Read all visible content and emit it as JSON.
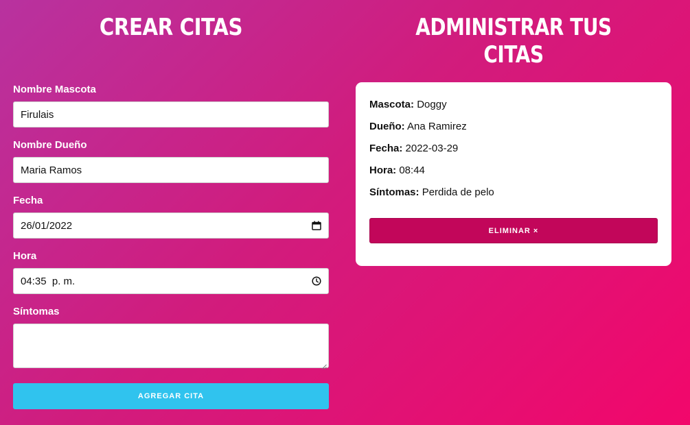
{
  "create": {
    "title": "Crear Citas",
    "fields": {
      "pet": {
        "label": "Nombre Mascota",
        "value": "Firulais"
      },
      "owner": {
        "label": "Nombre Dueño",
        "value": "Maria Ramos"
      },
      "date": {
        "label": "Fecha",
        "value": "26/01/2022"
      },
      "time": {
        "label": "Hora",
        "value": "04:35  p. m."
      },
      "symptoms": {
        "label": "Síntomas",
        "value": ""
      }
    },
    "submit_label": "Agregar Cita"
  },
  "manage": {
    "title": "Administrar tus Citas",
    "appointment": {
      "pet_label": "Mascota:",
      "pet": "Doggy",
      "owner_label": "Dueño:",
      "owner": "Ana Ramirez",
      "date_label": "Fecha:",
      "date": "2022-03-29",
      "time_label": "Hora:",
      "time": "08:44",
      "symptoms_label": "Síntomas:",
      "symptoms": "Perdida de pelo",
      "delete_label": "Eliminar ×"
    }
  },
  "colors": {
    "gradient_start": "#b8329f",
    "gradient_end": "#f2076b",
    "submit_button": "#30c3ee",
    "delete_button": "#c2065a"
  },
  "icons": {
    "date": "calendar-icon",
    "time": "clock-icon",
    "textarea": "resize-grip-icon"
  }
}
